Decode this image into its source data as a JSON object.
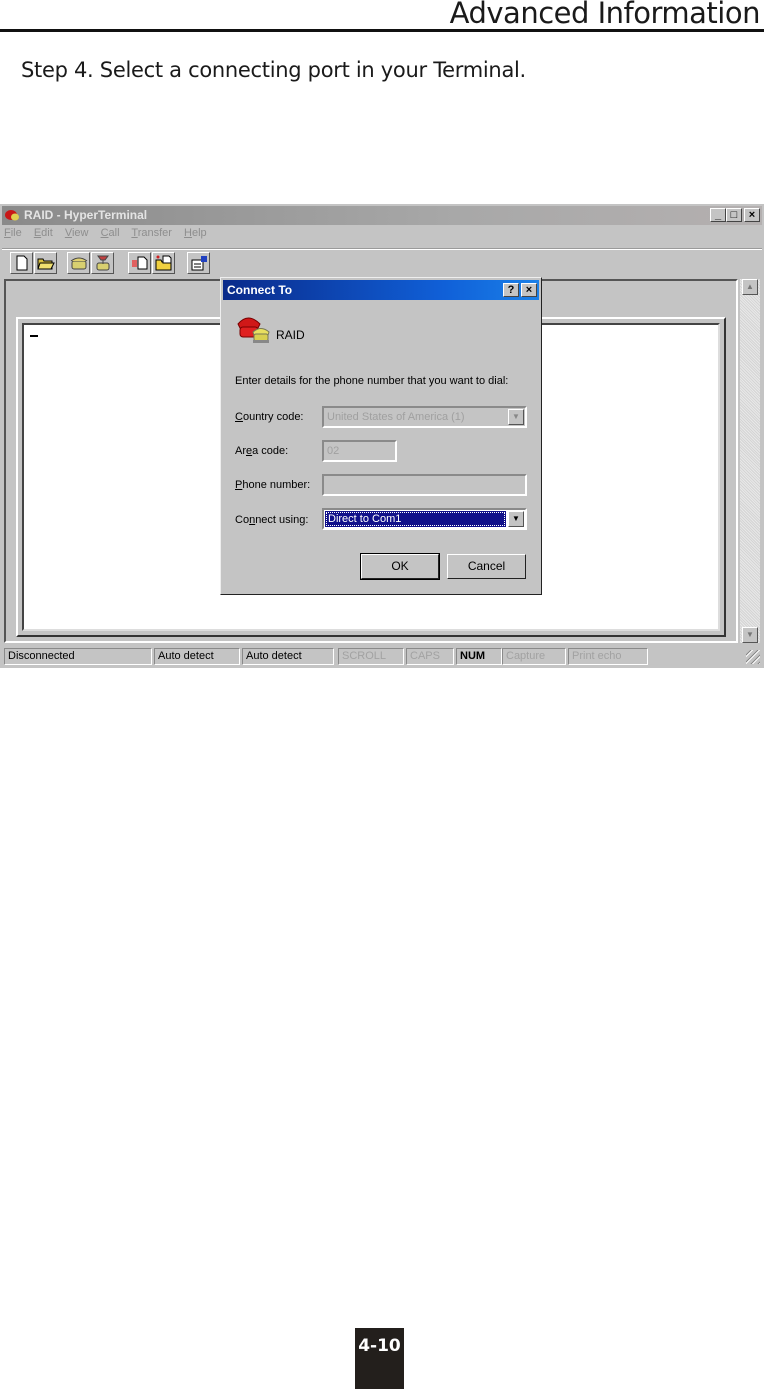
{
  "page": {
    "header_title": "Advanced Information",
    "step_text": "Step 4.  Select a connecting port in your Terminal.",
    "page_number": "4-10"
  },
  "window": {
    "title": "RAID - HyperTerminal",
    "controls": {
      "minimize": "_",
      "maximize": "□",
      "close": "×"
    },
    "menu": [
      {
        "label": "File",
        "accel": "F",
        "rest": "ile"
      },
      {
        "label": "Edit",
        "accel": "E",
        "rest": "dit"
      },
      {
        "label": "View",
        "accel": "V",
        "rest": "iew"
      },
      {
        "label": "Call",
        "accel": "C",
        "rest": "all"
      },
      {
        "label": "Transfer",
        "accel": "T",
        "rest": "ransfer"
      },
      {
        "label": "Help",
        "accel": "H",
        "rest": "elp"
      }
    ],
    "toolbar": [
      {
        "name": "new-icon"
      },
      {
        "name": "open-icon"
      },
      {
        "name": "connect-icon"
      },
      {
        "name": "disconnect-icon"
      },
      {
        "name": "send-icon"
      },
      {
        "name": "receive-icon"
      },
      {
        "name": "properties-icon"
      }
    ],
    "terminal_cursor": "_",
    "status": [
      {
        "text": "Disconnected",
        "state": "normal"
      },
      {
        "text": "Auto detect",
        "state": "normal"
      },
      {
        "text": "Auto detect",
        "state": "normal"
      },
      {
        "text": "SCROLL",
        "state": "dim"
      },
      {
        "text": "CAPS",
        "state": "dim"
      },
      {
        "text": "NUM",
        "state": "bold"
      },
      {
        "text": "Capture",
        "state": "dim"
      },
      {
        "text": "Print echo",
        "state": "dim"
      }
    ]
  },
  "dialog": {
    "title": "Connect To",
    "help_button": "?",
    "close_button": "×",
    "connection_name": "RAID",
    "prompt": "Enter details for the phone number that you want to dial:",
    "country_code": {
      "label_accel": "C",
      "label_rest": "ountry code:",
      "value": "United States of America (1)"
    },
    "area_code": {
      "label_pre": "Ar",
      "label_accel": "e",
      "label_rest": "a code:",
      "value": "02"
    },
    "phone_number": {
      "label_accel": "P",
      "label_rest": "hone number:",
      "value": ""
    },
    "connect_using": {
      "label_pre": "Co",
      "label_accel": "n",
      "label_rest": "nect using:",
      "value": "Direct to Com1"
    },
    "ok_label": "OK",
    "cancel_label": "Cancel"
  }
}
